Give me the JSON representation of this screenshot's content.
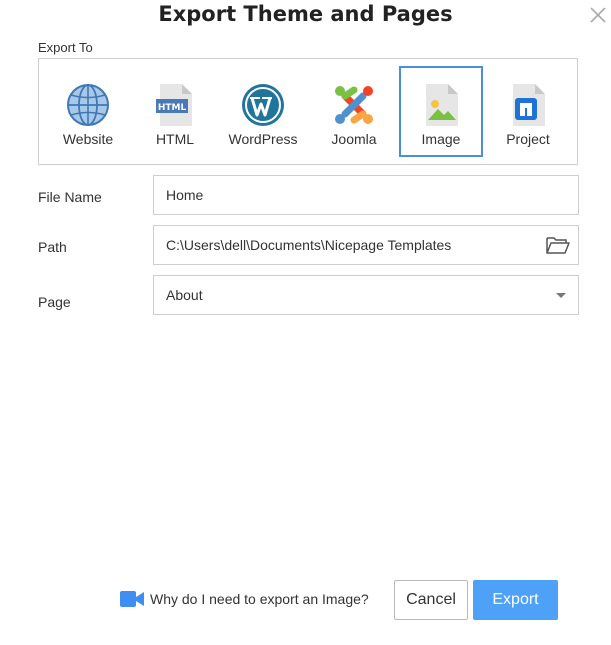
{
  "dialog": {
    "title": "Export Theme and Pages"
  },
  "export_to": {
    "label": "Export To",
    "selected": "Image",
    "targets": [
      {
        "label": "Website",
        "icon": "globe-icon"
      },
      {
        "label": "HTML",
        "icon": "html-file-icon"
      },
      {
        "label": "WordPress",
        "icon": "wordpress-icon"
      },
      {
        "label": "Joomla",
        "icon": "joomla-icon"
      },
      {
        "label": "Image",
        "icon": "image-file-icon"
      },
      {
        "label": "Project",
        "icon": "nicepage-file-icon"
      }
    ]
  },
  "form": {
    "file_name": {
      "label": "File Name",
      "value": "Home"
    },
    "path": {
      "label": "Path",
      "value": "C:\\Users\\dell\\Documents\\Nicepage Templates"
    },
    "page": {
      "label": "Page",
      "value": "About"
    }
  },
  "footer": {
    "help_text": "Why do I need to export an Image?",
    "cancel_label": "Cancel",
    "export_label": "Export"
  },
  "colors": {
    "accent": "#4da1f7",
    "selected_border": "#4a90d9",
    "border": "#cfcfcf"
  }
}
